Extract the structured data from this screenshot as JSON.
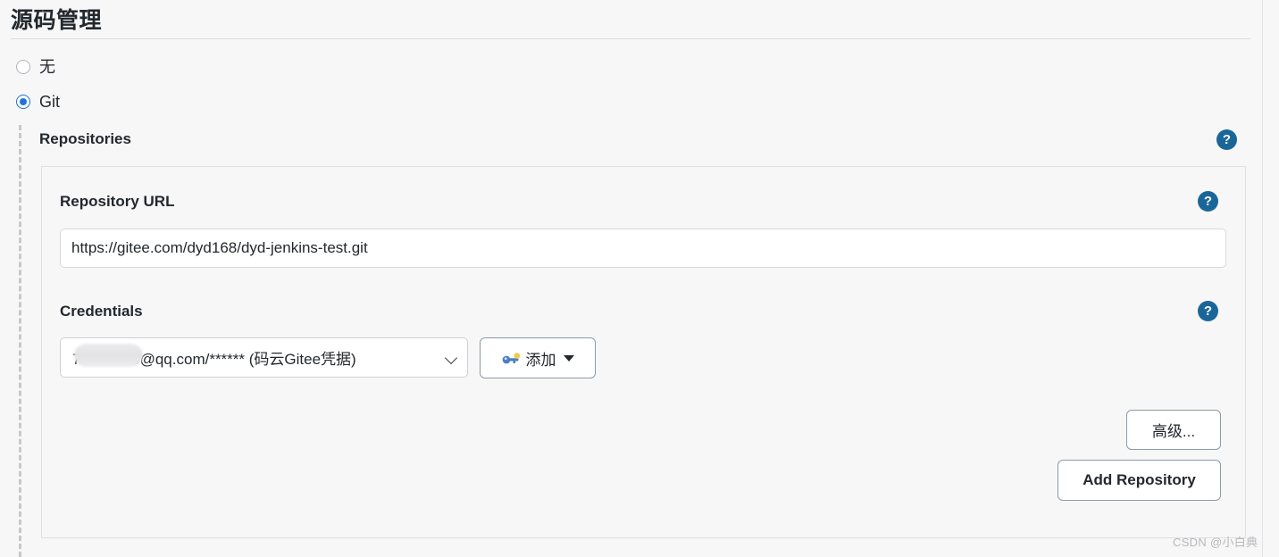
{
  "section": {
    "title": "源码管理"
  },
  "scm_options": [
    {
      "label": "无",
      "selected": false,
      "icon": "radio-unchecked-icon"
    },
    {
      "label": "Git",
      "selected": true,
      "icon": "radio-checked-icon"
    }
  ],
  "repositories": {
    "label": "Repositories",
    "help_icon": "?",
    "repository_url": {
      "label": "Repository URL",
      "value": "https://gitee.com/dyd168/dyd-jenkins-test.git",
      "placeholder": "",
      "help_icon": "?"
    },
    "credentials": {
      "label": "Credentials",
      "selected_option": "7          76@qq.com/****** (码云Gitee凭据)",
      "help_icon": "?",
      "dropdown_icon": "chevron-down-icon",
      "add_button": {
        "label": "添加",
        "icon": "key-icon",
        "caret": "caret-down-icon"
      }
    },
    "advanced_button": "高级...",
    "add_repository_button": "Add Repository"
  },
  "watermark": "CSDN @小白典",
  "colors": {
    "page_background": "#f7f7f8",
    "accent_radio": "#1f76e0",
    "help_icon_background": "#1a6699",
    "button_border": "#8c9aa6",
    "input_border": "#d8d8da",
    "panel_border": "#e0e0e2",
    "title_rule": "#dcdcde",
    "dashed_guide": "#c8c8c8",
    "key_icon_body": "#4a7fc1",
    "key_icon_head": "#f2c94c",
    "watermark": "#b8b8bc"
  }
}
